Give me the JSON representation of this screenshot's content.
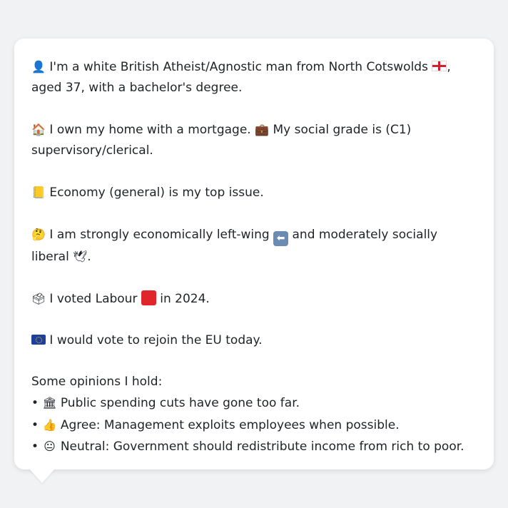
{
  "profile": {
    "identity": {
      "icon": "person-silhouette-icon",
      "text_before": "I'm a white British Atheist/Agnostic man from North Cotswolds",
      "flag": "england-flag-icon",
      "text_after": ", aged 37, with a bachelor's degree."
    },
    "housing": {
      "icon": "house-icon",
      "text": "I own my home with a mortgage.",
      "grade_icon": "briefcase-icon",
      "grade_text": "My social grade is (C1) supervisory/clerical."
    },
    "issue": {
      "icon": "ledger-icon",
      "text": "Economy (general) is my top issue."
    },
    "ideology": {
      "icon": "thinking-face-icon",
      "text_before": "I am strongly economically left-wing",
      "left_icon": "left-arrow-icon",
      "text_middle": "and moderately socially liberal",
      "liberal_icon": "dove-icon",
      "text_after": "."
    },
    "vote": {
      "icon": "ballot-box-icon",
      "text_before": "I voted Labour",
      "party_icon": "red-square-icon",
      "text_after": "in 2024."
    },
    "eu": {
      "icon": "eu-flag-icon",
      "text": "I would vote to rejoin the EU today."
    },
    "opinions": {
      "heading": "Some opinions I hold:",
      "bullet": "•",
      "items": [
        {
          "icon": "classical-building-icon",
          "text": "Public spending cuts have gone too far."
        },
        {
          "icon": "thumbs-up-icon",
          "text": "Agree: Management exploits employees when possible."
        },
        {
          "icon": "neutral-face-icon",
          "text": "Neutral: Government should redistribute income from rich to poor."
        }
      ]
    }
  },
  "emoji": {
    "person": "👤",
    "house": "🏠",
    "briefcase": "💼",
    "ledger": "📒",
    "thinking": "🤔",
    "arrow": "⬅",
    "dove": "🕊",
    "ballot": "🗳",
    "building": "🏛",
    "thumbs": "👍",
    "neutral": "😐"
  }
}
